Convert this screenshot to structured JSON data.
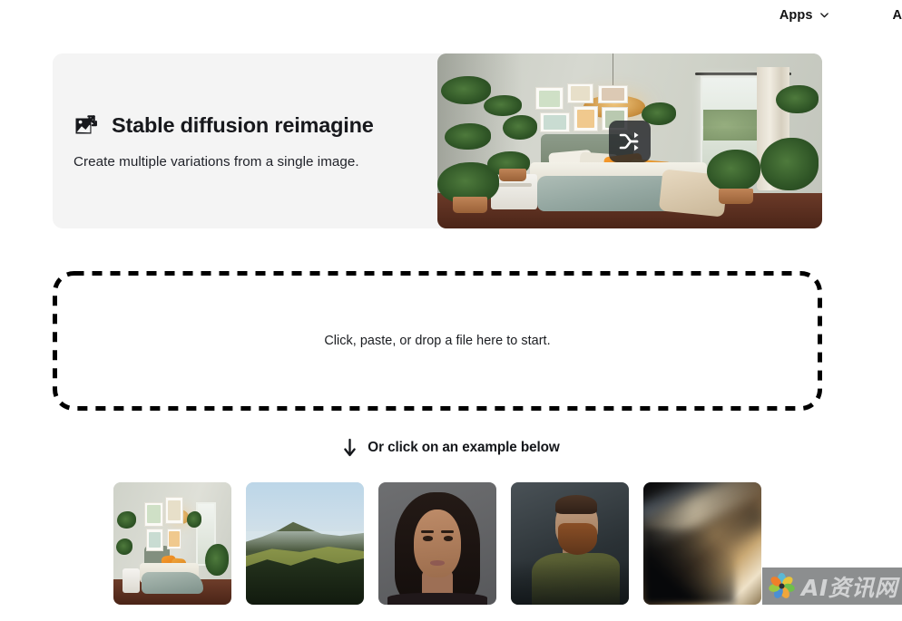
{
  "header": {
    "nav": [
      {
        "label": "Apps",
        "icon": "chevron-down-icon"
      },
      {
        "label": "API"
      }
    ]
  },
  "hero": {
    "icon": "image-reimagine-icon",
    "title": "Stable diffusion reimagine",
    "subtitle": "Create multiple variations from a single image.",
    "image_alt": "plant-filled bedroom interior",
    "overlay_icon": "shuffle-icon",
    "background_color": "#f4f4f4"
  },
  "dropzone": {
    "label": "Click, paste, or drop a file here to start.",
    "border_color": "#000000",
    "border_style": "dashed"
  },
  "examples": {
    "arrow_icon": "arrow-down-icon",
    "heading": "Or click on an example below",
    "items": [
      {
        "name": "example-bedroom",
        "alt": "Bedroom with plants"
      },
      {
        "name": "example-landscape",
        "alt": "Mountain landscape"
      },
      {
        "name": "example-woman-portrait",
        "alt": "Portrait of a woman"
      },
      {
        "name": "example-bearded-man",
        "alt": "Bearded man in olive shirt"
      },
      {
        "name": "example-abstract",
        "alt": "Abstract motion blur"
      }
    ]
  },
  "watermark": {
    "text": "AI资讯网",
    "logo_icon": "flower-logo-icon",
    "colors": [
      "#e8c33a",
      "#5bb8d4",
      "#6fbf4a",
      "#f07f2a",
      "#4a8fd4",
      "#9bc83f"
    ]
  }
}
